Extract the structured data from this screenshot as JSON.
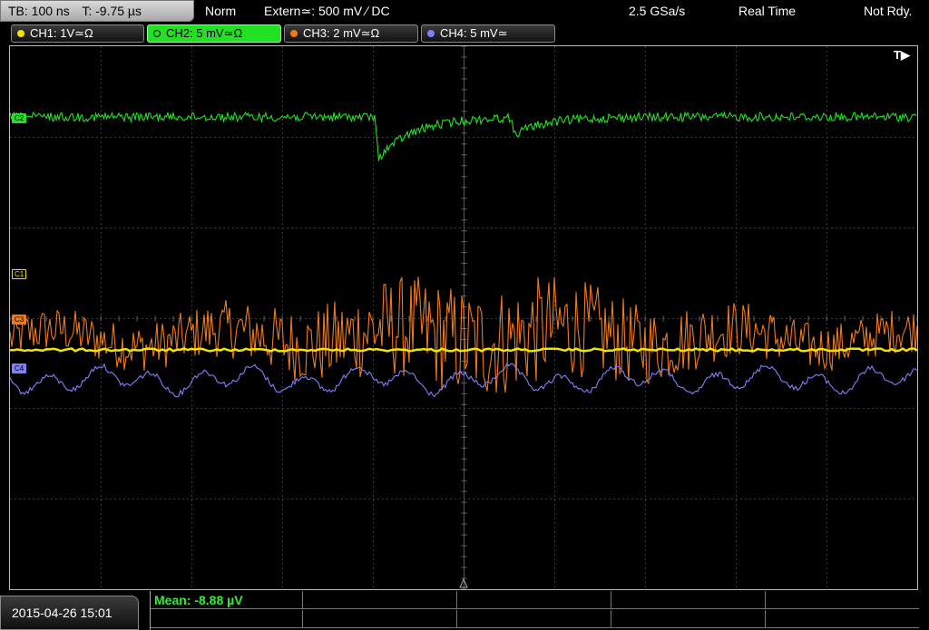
{
  "header": {
    "timebase": "TB: 100 ns",
    "trigger_time": "T: -9.75 µs",
    "acq_mode": "Norm",
    "trigger_source": "Extern≃: 500 mV ∕ DC",
    "sample_rate": "2.5 GSa/s",
    "realtime": "Real Time",
    "state": "Not Rdy."
  },
  "channels": [
    {
      "label": "CH1: 1V≃Ω",
      "color": "#f2e200",
      "active": false
    },
    {
      "label": "CH2: 5 mV≃Ω",
      "color": "#22e022",
      "active": true
    },
    {
      "label": "CH3: 2 mV≃Ω",
      "color": "#f07a1a",
      "active": false
    },
    {
      "label": "CH4: 5 mV≃",
      "color": "#8080ff",
      "active": false
    }
  ],
  "markers": {
    "c1": "C1",
    "c2": "C2",
    "c3": "C3",
    "c4": "C4",
    "trigger_pos": "T▶"
  },
  "footer": {
    "datetime": "2015-04-26 15:01",
    "measurement": "Mean: -8.88 µV"
  }
}
